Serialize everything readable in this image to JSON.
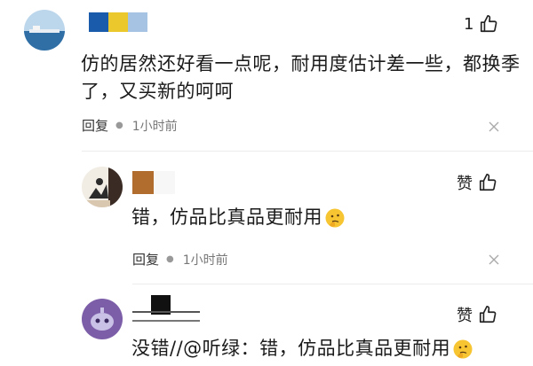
{
  "comments": [
    {
      "likes": "1",
      "text_line1": "仿的居然还好看一点呢，耐用度估计差一些，都换季",
      "text_line2": "了，又买新的呵呵",
      "reply_label": "回复",
      "time": "1小时前"
    },
    {
      "like_label": "赞",
      "text": "错，仿品比真品更耐用",
      "reply_label": "回复",
      "time": "1小时前"
    },
    {
      "like_label": "赞",
      "text": "没错//@听绿：错，仿品比真品更耐用"
    }
  ],
  "colors": {
    "square_blue": "#1a5cab",
    "square_gold": "#ebc92c",
    "square_light_blue": "#a6c3e3",
    "square_brown": "#b06d2e",
    "square_black": "#111111"
  }
}
